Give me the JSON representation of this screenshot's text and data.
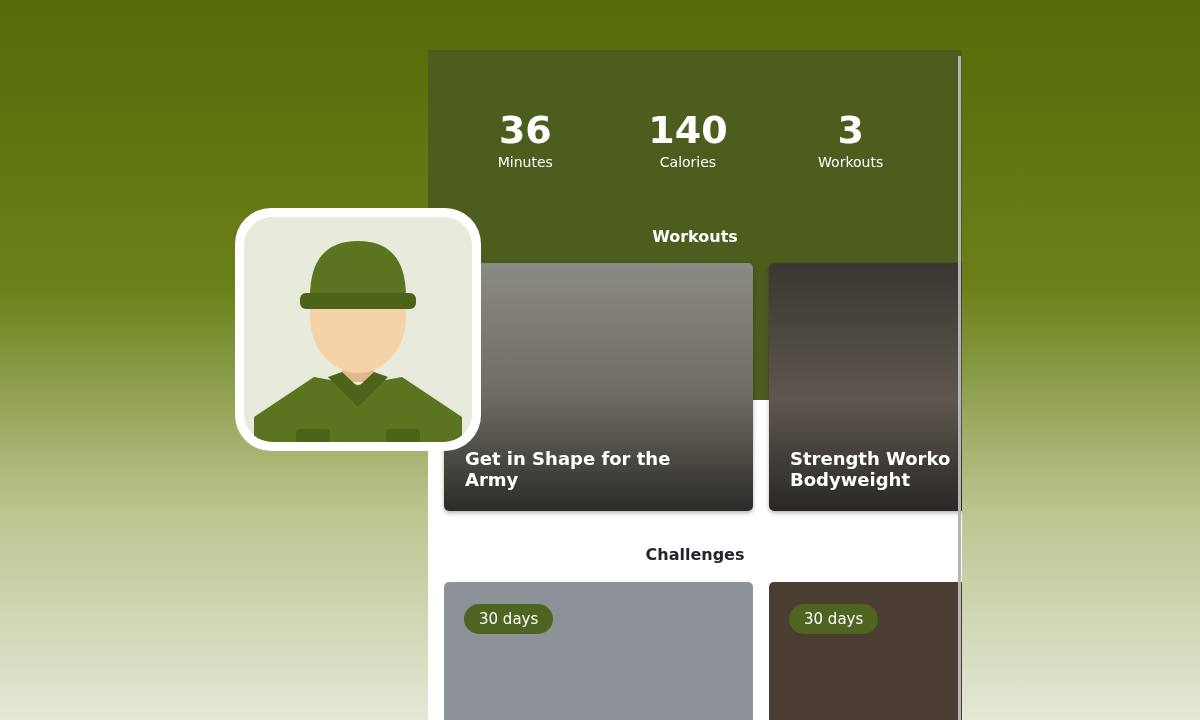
{
  "stats": [
    {
      "value": "36",
      "label": "Minutes"
    },
    {
      "value": "140",
      "label": "Calories"
    },
    {
      "value": "3",
      "label": "Workouts"
    }
  ],
  "workouts": {
    "heading": "Workouts",
    "cards": [
      {
        "title_lines": [
          "Get in Shape for the",
          "Army"
        ]
      },
      {
        "title_lines": [
          "Strength Worko",
          "Bodyweight"
        ]
      }
    ]
  },
  "challenges": {
    "heading": "Challenges",
    "cards": [
      {
        "badge": "30 days"
      },
      {
        "badge": "30 days"
      }
    ]
  }
}
